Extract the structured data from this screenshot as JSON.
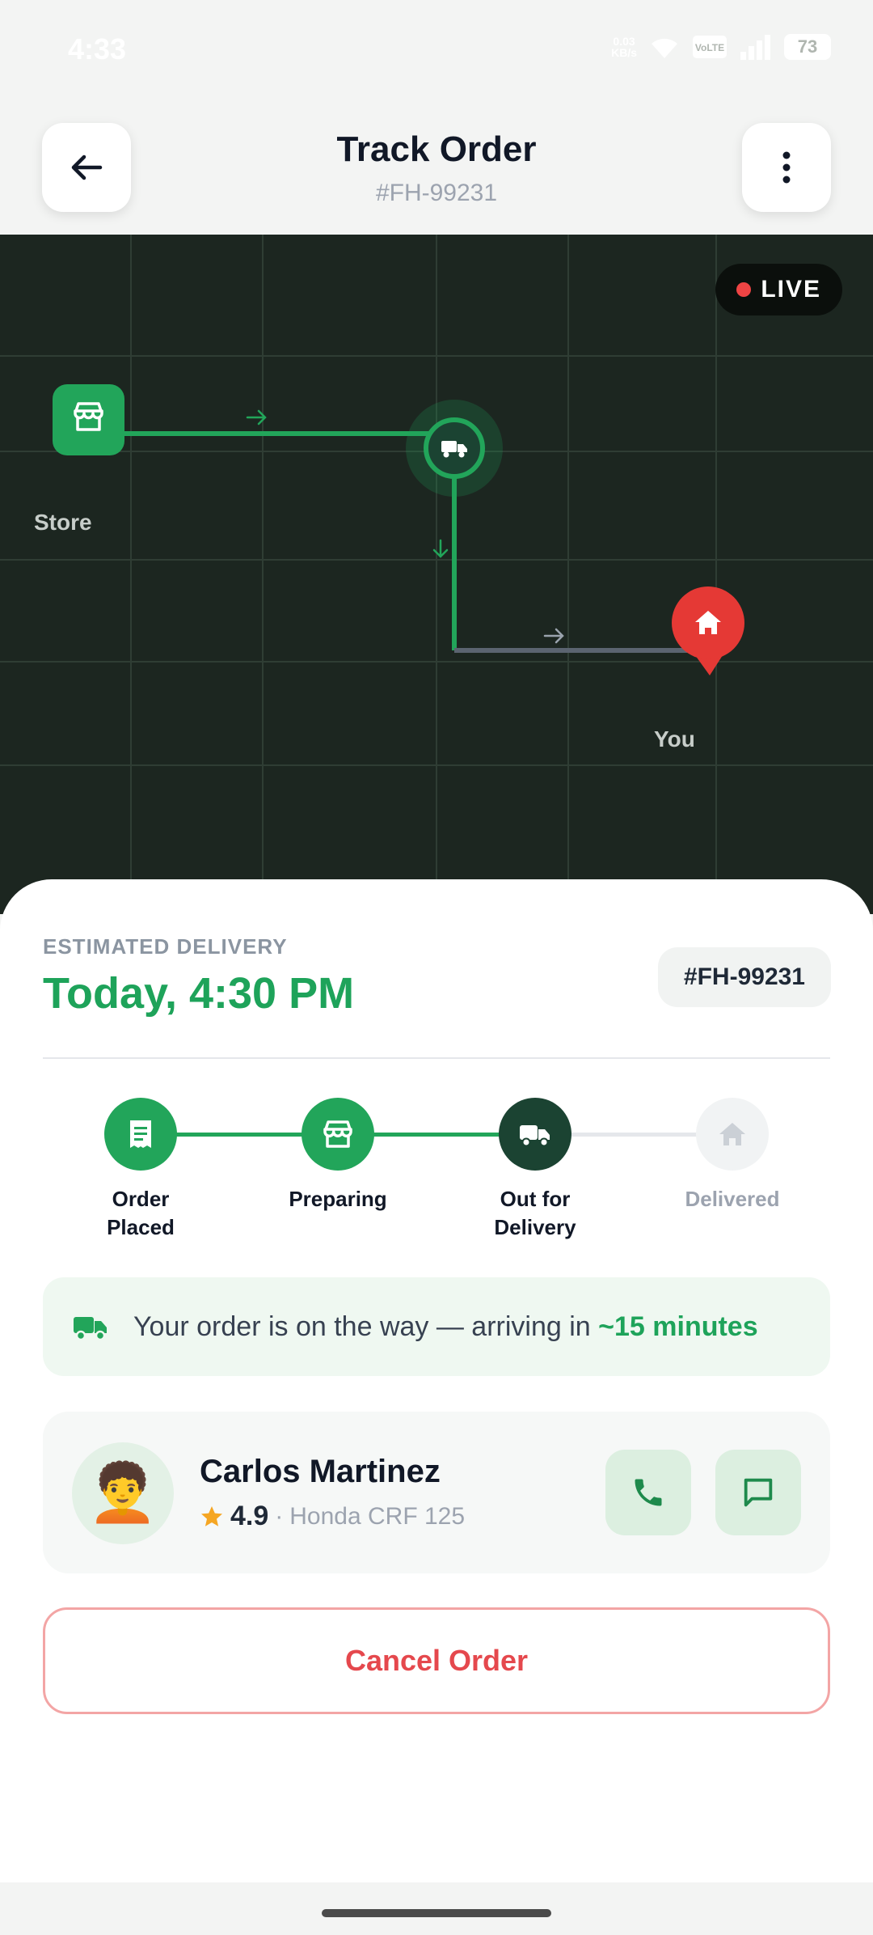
{
  "status_bar": {
    "time": "4:33",
    "net_speed": "0.03",
    "net_unit": "KB/s",
    "battery": "73"
  },
  "header": {
    "title": "Track Order",
    "order_id": "#FH-99231"
  },
  "map": {
    "live_label": "LIVE",
    "store_label": "Store",
    "you_label": "You",
    "route_color": "#22a55a",
    "destination_color": "#e53935"
  },
  "eta": {
    "label": "ESTIMATED DELIVERY",
    "value": "Today, 4:30 PM",
    "order_chip": "#FH-99231"
  },
  "steps": [
    {
      "label_line1": "Order",
      "label_line2": "Placed",
      "state": "done",
      "icon": "receipt-icon"
    },
    {
      "label_line1": "Preparing",
      "label_line2": "",
      "state": "done",
      "icon": "store-icon"
    },
    {
      "label_line1": "Out for",
      "label_line2": "Delivery",
      "state": "current",
      "icon": "truck-icon"
    },
    {
      "label_line1": "Delivered",
      "label_line2": "",
      "state": "pending",
      "icon": "home-icon"
    }
  ],
  "banner": {
    "text": "Your order is on the way — arriving in ",
    "highlight": "~15 minutes"
  },
  "driver": {
    "name": "Carlos Martinez",
    "rating": "4.9",
    "separator": "·",
    "vehicle": "Honda CRF 125",
    "avatar": "🧑‍🦱"
  },
  "actions": {
    "cancel_label": "Cancel Order"
  },
  "colors": {
    "accent": "#1ea35a",
    "dark_green": "#1b4332",
    "danger": "#e5484d"
  }
}
